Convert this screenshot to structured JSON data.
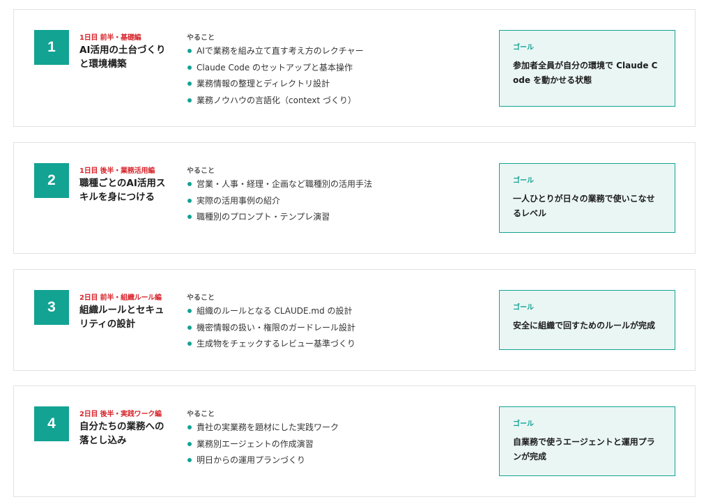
{
  "cards": [
    {
      "number": "1",
      "tag": "1日目 前半・基礎編",
      "title": "AI活用の土台づくりと環境構築",
      "todo_label": "やること",
      "items": [
        "AIで業務を組み立て直す考え方のレクチャー",
        "Claude Code のセットアップと基本操作",
        "業務情報の整理とディレクトリ設計",
        "業務ノウハウの言語化（context づくり）"
      ],
      "goal_label": "ゴール",
      "goal_text": "参加者全員が自分の環境で Claude Code を動かせる状態"
    },
    {
      "number": "2",
      "tag": "1日目 後半・業務活用編",
      "title": "職種ごとのAI活用スキルを身につける",
      "todo_label": "やること",
      "items": [
        "営業・人事・経理・企画など職種別の活用手法",
        "実際の活用事例の紹介",
        "職種別のプロンプト・テンプレ演習"
      ],
      "goal_label": "ゴール",
      "goal_text": "一人ひとりが日々の業務で使いこなせるレベル"
    },
    {
      "number": "3",
      "tag": "2日目 前半・組織ルール編",
      "title": "組織ルールとセキュリティの設計",
      "todo_label": "やること",
      "items": [
        "組織のルールとなる CLAUDE.md の設計",
        "機密情報の扱い・権限のガードレール設計",
        "生成物をチェックするレビュー基準づくり"
      ],
      "goal_label": "ゴール",
      "goal_text": "安全に組織で回すためのルールが完成"
    },
    {
      "number": "4",
      "tag": "2日目 後半・実践ワーク編",
      "title": "自分たちの業務への落とし込み",
      "todo_label": "やること",
      "items": [
        "貴社の実業務を題材にした実践ワーク",
        "業務別エージェントの作成演習",
        "明日からの運用プランづくり"
      ],
      "goal_label": "ゴール",
      "goal_text": "自業務で使うエージェントと運用プランが完成"
    }
  ]
}
